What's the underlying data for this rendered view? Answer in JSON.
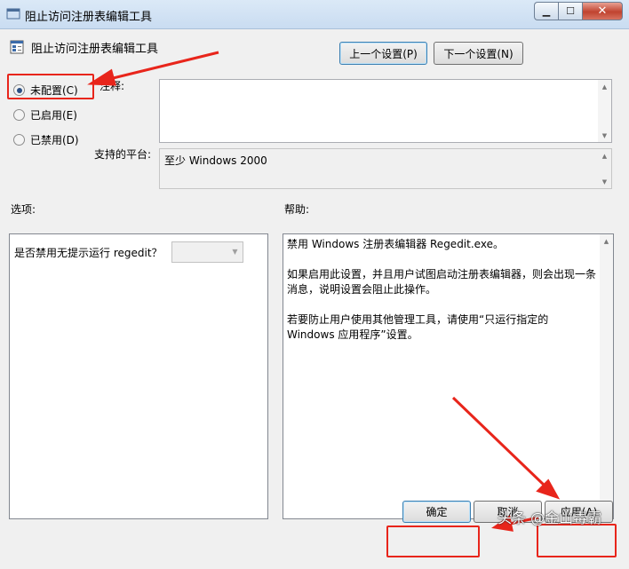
{
  "window": {
    "title": "阻止访问注册表编辑工具",
    "buttons": {
      "minimize": "▁",
      "maximize": "☐",
      "close": "✕"
    }
  },
  "policy": {
    "name": "阻止访问注册表编辑工具",
    "prev_button": "上一个设置(P)",
    "next_button": "下一个设置(N)"
  },
  "state_options": [
    {
      "label": "未配置(C)",
      "checked": true
    },
    {
      "label": "已启用(E)",
      "checked": false
    },
    {
      "label": "已禁用(D)",
      "checked": false
    }
  ],
  "comment": {
    "label": "注释:",
    "value": ""
  },
  "platform": {
    "label": "支持的平台:",
    "value": "至少 Windows 2000"
  },
  "options": {
    "label": "选项:",
    "item_label": "是否禁用无提示运行 regedit？",
    "item_value": ""
  },
  "help": {
    "label": "帮助:",
    "paragraphs": [
      "禁用 Windows 注册表编辑器 Regedit.exe。",
      "如果启用此设置，并且用户试图启动注册表编辑器，则会出现一条消息，说明设置会阻止此操作。",
      "若要防止用户使用其他管理工具，请使用“只运行指定的 Windows 应用程序”设置。"
    ]
  },
  "footer": {
    "ok": "确定",
    "cancel": "取消",
    "apply": "应用(A)"
  },
  "watermark": "头条 @金山毒霸",
  "colors": {
    "annotation": "#e8251b",
    "accent": "#3c7fb1"
  }
}
